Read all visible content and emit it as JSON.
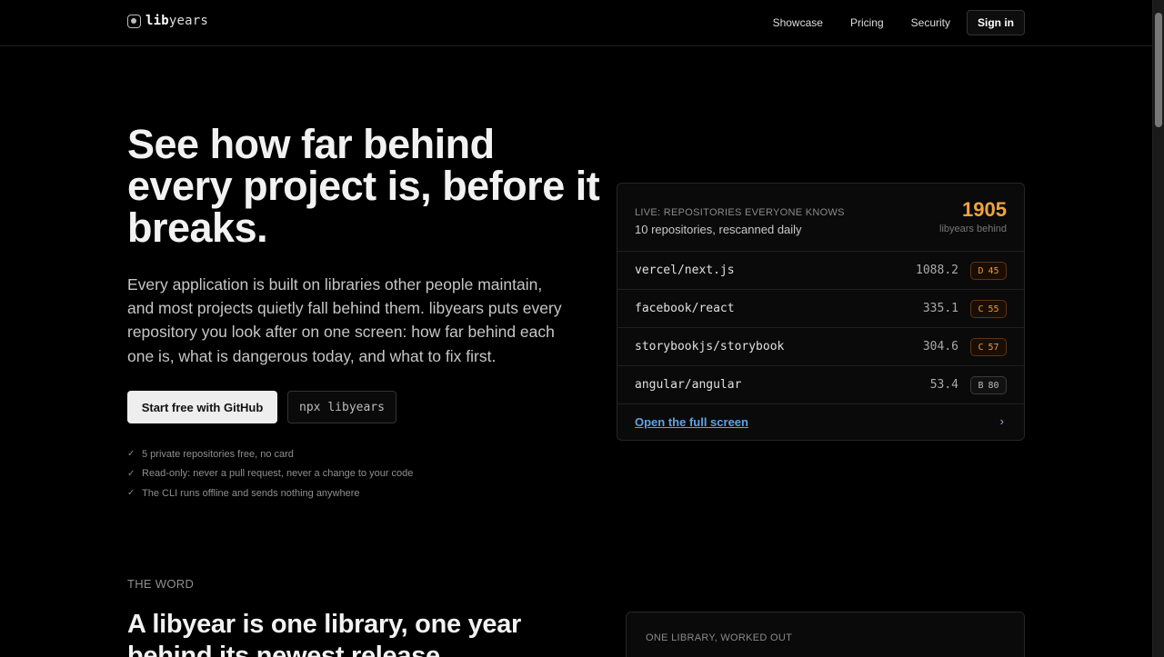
{
  "header": {
    "logo_bold": "lib",
    "logo_rest": "years",
    "nav": [
      "Showcase",
      "Pricing",
      "Security"
    ],
    "signin": "Sign in"
  },
  "hero": {
    "title": "See how far behind every project is, before it breaks.",
    "description": "Every application is built on libraries other people maintain, and most projects quietly fall behind them. libyears puts every repository you look after on one screen: how far behind each one is, what is dangerous today, and what to fix first.",
    "cta_primary": "Start free with GitHub",
    "cta_code": "npx libyears",
    "checks": [
      "5 private repositories free, no card",
      "Read-only: never a pull request, never a change to your code",
      "The CLI runs offline and sends nothing anywhere"
    ]
  },
  "card": {
    "eyebrow": "LIVE: REPOSITORIES EVERYONE KNOWS",
    "subtitle": "10 repositories, rescanned daily",
    "total": "1905",
    "total_label": "libyears behind",
    "repos": [
      {
        "name": "vercel/next.js",
        "value": "1088.2",
        "grade": "D",
        "score": "45"
      },
      {
        "name": "facebook/react",
        "value": "335.1",
        "grade": "C",
        "score": "55"
      },
      {
        "name": "storybookjs/storybook",
        "value": "304.6",
        "grade": "C",
        "score": "57"
      },
      {
        "name": "angular/angular",
        "value": "53.4",
        "grade": "B",
        "score": "80"
      }
    ],
    "footer_link": "Open the full screen",
    "footer_chevron": "›"
  },
  "section2": {
    "eyebrow": "THE WORD",
    "title": "A libyear is one library, one year behind its newest release.",
    "card_label": "ONE LIBRARY, WORKED OUT"
  },
  "colors": {
    "accent_orange": "#f0a340",
    "link_blue": "#5ea2e6",
    "background": "#000000"
  }
}
